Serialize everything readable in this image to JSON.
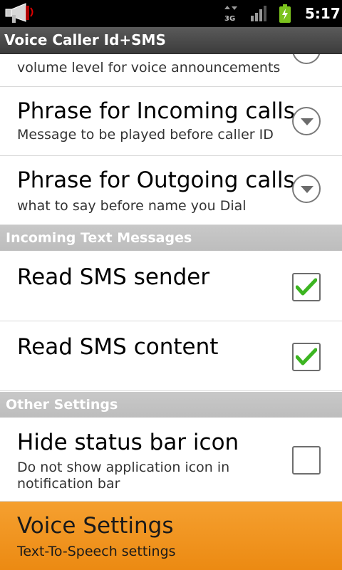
{
  "status_bar": {
    "time": "5:17",
    "network": "3G",
    "icons": [
      "megaphone-icon",
      "network-3g-icon",
      "signal-icon",
      "battery-charging-icon"
    ]
  },
  "title_bar": {
    "title": "Voice Caller Id+SMS"
  },
  "settings": {
    "partial_item": {
      "summary": "volume level for voice announcements",
      "widget": "dropdown"
    },
    "phrase_incoming": {
      "title": "Phrase for Incoming calls",
      "summary": "Message to be played before caller ID",
      "widget": "dropdown"
    },
    "phrase_outgoing": {
      "title": "Phrase for Outgoing calls",
      "summary": "what to say before name you Dial",
      "widget": "dropdown"
    },
    "incoming_text_header": "Incoming Text Messages",
    "read_sms_sender": {
      "title": "Read SMS sender",
      "checked": true
    },
    "read_sms_content": {
      "title": "Read SMS content",
      "checked": true
    },
    "other_settings_header": "Other Settings",
    "hide_status_bar_icon": {
      "title": "Hide status bar icon",
      "summary": "Do not show application icon in notification bar",
      "checked": false
    },
    "voice_settings": {
      "title": "Voice Settings",
      "summary": "Text-To-Speech settings",
      "highlighted": true
    }
  },
  "colors": {
    "highlight": "#ef8f18",
    "check": "#3cb521",
    "header_bg": "#c4c4c4",
    "titlebar_bg": "#4a4a4a"
  }
}
